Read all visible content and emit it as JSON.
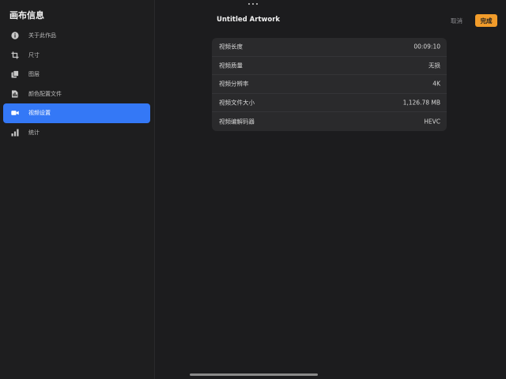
{
  "sidebar": {
    "title": "画布信息",
    "items": [
      {
        "label": "关于此作品",
        "icon": "info-icon",
        "active": false
      },
      {
        "label": "尺寸",
        "icon": "crop-icon",
        "active": false
      },
      {
        "label": "图层",
        "icon": "layers-icon",
        "active": false
      },
      {
        "label": "颜色配置文件",
        "icon": "color-profile-icon",
        "active": false
      },
      {
        "label": "视频设置",
        "icon": "video-camera-icon",
        "active": true
      },
      {
        "label": "统计",
        "icon": "bar-chart-icon",
        "active": false
      }
    ]
  },
  "header": {
    "title": "Untitled Artwork",
    "cancel_label": "取消",
    "done_label": "完成"
  },
  "video_info": {
    "rows": [
      {
        "label": "视频长度",
        "value": "00:09:10"
      },
      {
        "label": "视频质量",
        "value": "无损"
      },
      {
        "label": "视频分辨率",
        "value": "4K"
      },
      {
        "label": "视频文件大小",
        "value": "1,126.78 MB"
      },
      {
        "label": "视频编解码器",
        "value": "HEVC"
      }
    ]
  },
  "colors": {
    "accent_blue": "#3478f6",
    "done_orange": "#f29c2b",
    "background": "#1c1c1e",
    "card": "#2a2a2c"
  }
}
